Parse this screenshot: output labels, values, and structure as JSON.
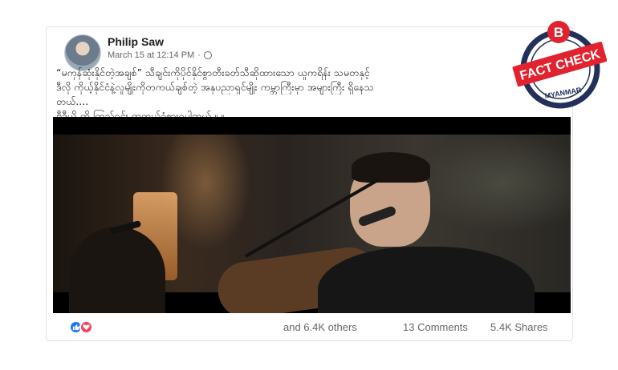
{
  "post": {
    "author": "Philip Saw",
    "timestamp": "March 15 at 12:14 PM",
    "lines": [
      "“မကုန်ဆုံးနိုင်တဲ့အချစ်” သီချင်းကိုပိုင်နိုင်စွာတီးခတ်သီဆိုထားသော ယူကရိန်း သမတနှင့်",
      "ဒီလို ကိုယ့်နိုင်ငံနဲ့လူမျိုးကိုတကယ်ချစ်တဲ့ အနုပညာရှင်မျိုး ကမ္ဘာကြီးမှာ အများကြီး ရှိနေသ",
      "တယ်....",
      "ဗီဒီယို ကို ကြည့်ရင်း တကယ်ခံစားရပါတယ် ။ ။"
    ]
  },
  "footer": {
    "reactions_count": "and 6.4K others",
    "comments": "13 Comments",
    "shares": "5.4K Shares"
  },
  "badge": {
    "letter": "B",
    "line1": "FACT CHECK",
    "line2": "MYANMAR"
  },
  "colors": {
    "badge_red": "#e0232e",
    "badge_navy": "#23305a",
    "like_blue": "#1877f2",
    "love_red": "#f33e58"
  },
  "icons": [
    "globe-icon",
    "like-reaction-icon",
    "love-reaction-icon",
    "fact-check-badge-logo"
  ]
}
